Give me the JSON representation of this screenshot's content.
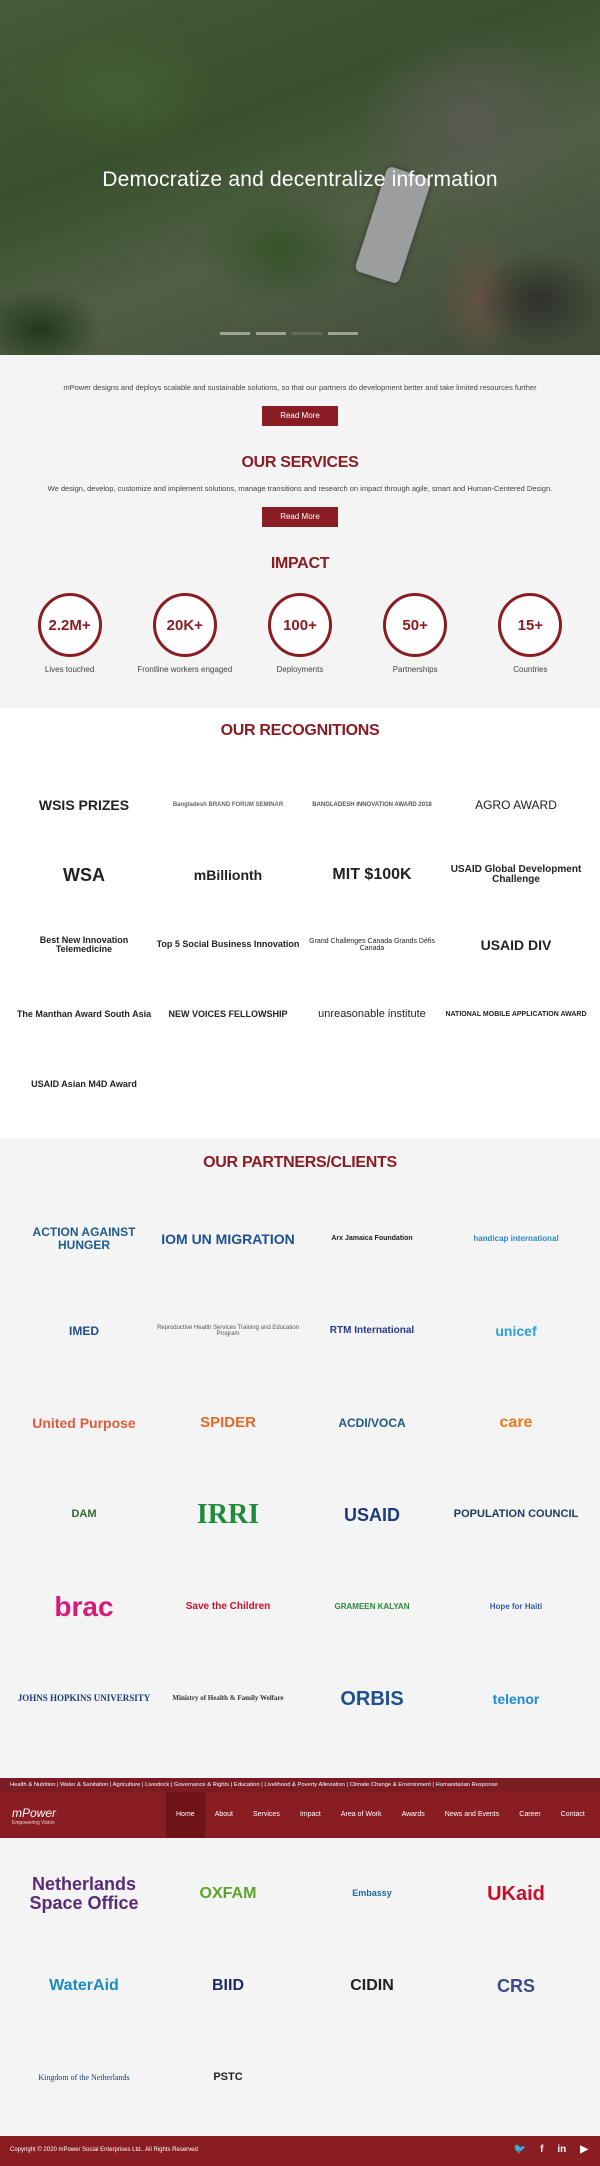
{
  "hero": {
    "headline": "Democratize and decentralize information"
  },
  "intro": {
    "text": "mPower designs and deploys scalable and sustainable solutions, so that our partners do development better and take limited resources further",
    "button": "Read More"
  },
  "services": {
    "title": "OUR SERVICES",
    "text": "We design, develop, customize and implement solutions, manage transitions and research on impact through agile, smart and Human-Centered Design.",
    "button": "Read More"
  },
  "impact": {
    "title": "IMPACT",
    "items": [
      {
        "value": "2.2M+",
        "label": "Lives touched"
      },
      {
        "value": "20K+",
        "label": "Frontline workers engaged"
      },
      {
        "value": "100+",
        "label": "Deployments"
      },
      {
        "value": "50+",
        "label": "Partnerships"
      },
      {
        "value": "15+",
        "label": "Countries"
      }
    ]
  },
  "recognitions": {
    "title": "OUR RECOGNITIONS",
    "items": [
      "WSIS PRIZES",
      "Bangladesh BRAND FORUM SEMINAR",
      "BANGLADESH INNOVATION AWARD 2018",
      "AGRO AWARD",
      "WSA",
      "mBillionth",
      "MIT $100K",
      "USAID Global Development Challenge",
      "Best New Innovation Telemedicine",
      "Top 5 Social Business Innovation",
      "Grand Challenges Canada Grands Défis Canada",
      "USAID DIV",
      "The Manthan Award South Asia",
      "NEW VOICES FELLOWSHIP",
      "unreasonable institute",
      "NATIONAL MOBILE APPLICATION AWARD",
      "USAID Asian M4D Award"
    ]
  },
  "partners": {
    "title": "OUR PARTNERS/CLIENTS",
    "items": [
      "ACTION AGAINST HUNGER",
      "IOM UN MIGRATION",
      "Arx Jamaica Foundation",
      "handicap international",
      "IMED",
      "Reproductive Health Services Training and Education Program",
      "RTM International",
      "unicef",
      "United Purpose",
      "SPIDER",
      "ACDI/VOCA",
      "care",
      "DAM",
      "IRRI",
      "USAID",
      "POPULATION COUNCIL",
      "brac",
      "Save the Children",
      "GRAMEEN KALYAN",
      "Hope for Haiti",
      "JOHNS HOPKINS UNIVERSITY",
      "Ministry of Health & Family Welfare",
      "ORBIS",
      "telenor",
      "Netherlands Space Office",
      "OXFAM",
      "Embassy",
      "UKaid",
      "WaterAid",
      "BIID",
      "CIDIN",
      "CRS",
      "Kingdom of the Netherlands",
      "PSTC"
    ]
  },
  "topbar": {
    "text": "Health & Nutrition  |  Water & Sanitation  |  Agriculture  |  Livestock  |  Governance & Rights  |  Education  |  Livelihood & Poverty Alleviation  |  Climate Change & Environment  |  Humanitarian Response"
  },
  "nav": {
    "brand": "mPower",
    "tagline": "Empowering Vision",
    "items": [
      "Home",
      "About",
      "Services",
      "Impact",
      "Area of Work",
      "Awards",
      "News and Events",
      "Career",
      "Contact"
    ]
  },
  "footer": {
    "copyright": "Copyright © 2020 mPower Social Enterprises Ltd.. All Rights Reserved",
    "social": [
      "twitter",
      "facebook",
      "linkedin",
      "youtube"
    ]
  },
  "colors": {
    "brand": "#8a1c23"
  }
}
